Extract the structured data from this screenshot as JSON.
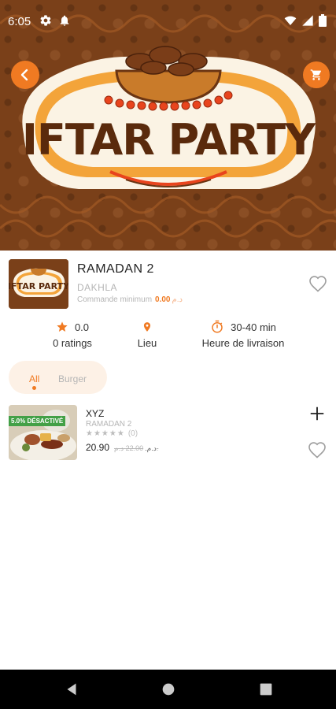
{
  "status_bar": {
    "time": "6:05",
    "icons_left": [
      "gear-icon",
      "bell-icon"
    ],
    "icons_right": [
      "wifi-icon",
      "signal-icon",
      "battery-icon"
    ]
  },
  "hero": {
    "banner_text": "IFTAR PARTY",
    "colors": {
      "brown": "#7a4019",
      "orange": "#f07a22",
      "cream": "#fbf3e4"
    }
  },
  "restaurant": {
    "name": "RAMADAN 2",
    "city": "DAKHLA",
    "min_order_label": "Commande minimum",
    "min_order_value": "0.00",
    "currency": "د.م",
    "thumb_text": "IFTAR PARTY"
  },
  "stats": {
    "rating_value": "0.0",
    "rating_label": "0 ratings",
    "location_label": "Lieu",
    "delivery_time": "30-40 min",
    "delivery_label": "Heure de livraison"
  },
  "tabs": [
    {
      "label": "All",
      "active": true
    },
    {
      "label": "Burger",
      "active": false
    }
  ],
  "products": [
    {
      "badge": "5.0% DÉSACTIVÉ",
      "name": "XYZ",
      "restaurant": "RAMADAN 2",
      "rating_stars": 0,
      "rating_count": "(0)",
      "price": "20.90",
      "currency": "د.م.",
      "old_price": "22.00",
      "old_currency": "د.م."
    }
  ],
  "accent_color": "#f07a22"
}
